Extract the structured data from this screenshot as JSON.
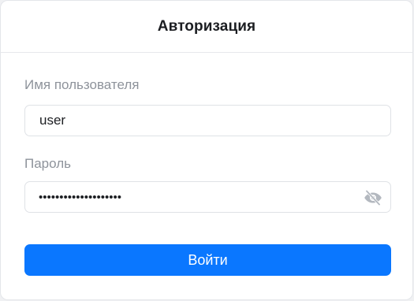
{
  "header": {
    "title": "Авторизация"
  },
  "form": {
    "username": {
      "label": "Имя пользователя",
      "value": "user"
    },
    "password": {
      "label": "Пароль",
      "value": "••••••••••••••••••••",
      "toggle_icon": "eye-slash-icon"
    },
    "submit_label": "Войти"
  },
  "colors": {
    "accent": "#0a77ff",
    "label": "#8e939b",
    "border": "#dfe2e6",
    "icon": "#b3b8bf"
  }
}
